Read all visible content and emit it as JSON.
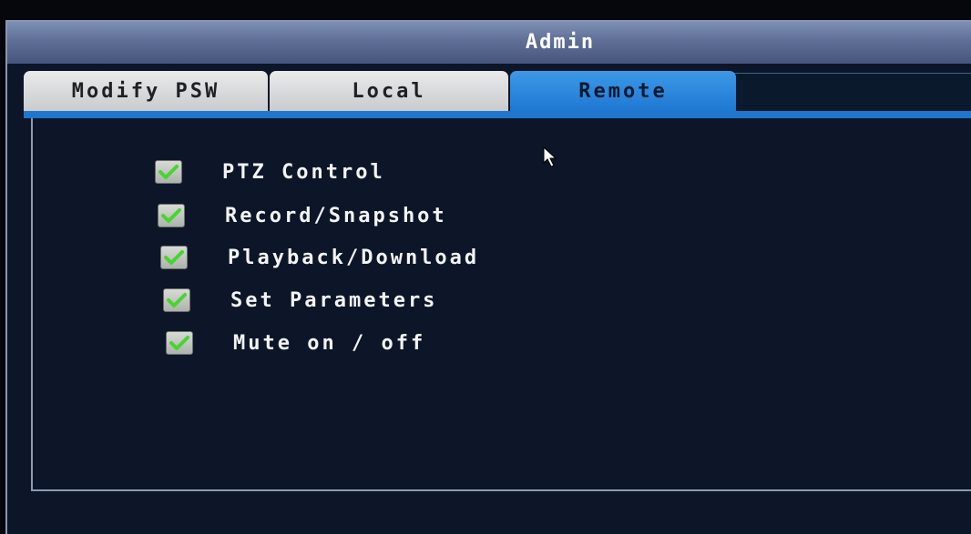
{
  "window": {
    "title": "Admin"
  },
  "tabs": [
    {
      "label": "Modify PSW",
      "active": false
    },
    {
      "label": "Local",
      "active": false
    },
    {
      "label": "Remote",
      "active": true
    }
  ],
  "permissions": [
    {
      "label": "PTZ Control",
      "checked": true
    },
    {
      "label": "Record/Snapshot",
      "checked": true
    },
    {
      "label": "Playback/Download",
      "checked": true
    },
    {
      "label": "Set Parameters",
      "checked": true
    },
    {
      "label": "Mute on / off",
      "checked": true
    }
  ],
  "colors": {
    "active_tab": "#1f78d2",
    "checkmark": "#45d62f",
    "window_background": "#0c1628"
  },
  "icons": {
    "cursor": "arrow-cursor-icon",
    "check": "checkmark-icon"
  }
}
